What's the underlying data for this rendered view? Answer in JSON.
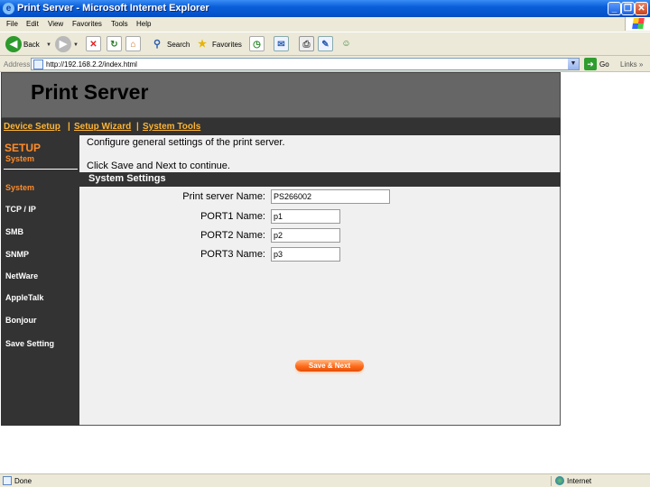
{
  "window": {
    "title": "Print Server - Microsoft Internet Explorer",
    "min": "_",
    "max": "❐",
    "close": "✕"
  },
  "menu": [
    "File",
    "Edit",
    "View",
    "Favorites",
    "Tools",
    "Help"
  ],
  "toolbar": {
    "back": "Back",
    "search": "Search",
    "favorites": "Favorites"
  },
  "address": {
    "label": "Address",
    "url": "http://192.168.2.2/index.html",
    "go": "Go",
    "links": "Links »"
  },
  "banner": {
    "title": "Print Server"
  },
  "topnav": {
    "items": [
      "Device Setup",
      "Setup Wizard",
      "System Tools"
    ],
    "sep1": "|",
    "sep2": "|"
  },
  "sidebar": {
    "heading": "SETUP",
    "subheading": "System",
    "items": [
      "System",
      "TCP / IP",
      "SMB",
      "SNMP",
      "NetWare",
      "AppleTalk",
      "Bonjour",
      "Save Setting"
    ]
  },
  "content": {
    "intro1": "Configure general settings of the print server.",
    "intro2": "Click Save and Next to continue.",
    "section": "System Settings",
    "fields": [
      {
        "label": "Print server Name:",
        "value": "PS266002"
      },
      {
        "label": "PORT1 Name:",
        "value": "p1"
      },
      {
        "label": "PORT2 Name:",
        "value": "p2"
      },
      {
        "label": "PORT3 Name:",
        "value": "p3"
      }
    ],
    "save_button": "Save & Next"
  },
  "status": {
    "text": "Done",
    "zone": "Internet"
  },
  "colors": {
    "accent_orange": "#ff8c2a",
    "nav_link": "#ffb533",
    "dark_bar": "#333333",
    "banner": "#666666"
  }
}
